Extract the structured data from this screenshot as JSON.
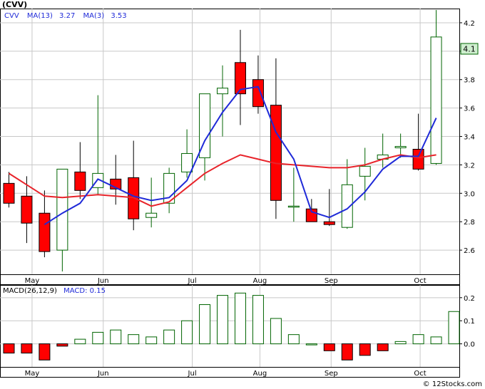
{
  "ticker": "(CVV)",
  "credit": "© 12Stocks.com",
  "price_badge": "4.1",
  "colors": {
    "up": "#006400",
    "down": "#ff0000",
    "ma13": "#e8232a",
    "ma3": "#1f2ad8",
    "grid": "#c8c8c8",
    "axis": "#000000",
    "label_blue": "#1f2ad8",
    "badge_bg": "#cfeecf"
  },
  "price_legend": {
    "series_name": "CVV",
    "ma13_label": "MA(13)",
    "ma13_value": "3.27",
    "ma3_label": "MA(3)",
    "ma3_value": "3.53"
  },
  "macd_legend": {
    "label": "MACD(26,12,9)",
    "value_label": "MACD: 0.15"
  },
  "chart_data": [
    {
      "type": "candlestick",
      "title": "(CVV)",
      "x_labels": [
        "May",
        "Jun",
        "Jul",
        "Aug",
        "Sep",
        "Oct"
      ],
      "x_label_weeks": [
        1.3,
        5.3,
        10.3,
        14.1,
        18.1,
        23.1
      ],
      "y_ticks": [
        "2.6",
        "2.8",
        "3.0",
        "3.2",
        "3.4",
        "3.6",
        "3.8",
        "4.0",
        "4.2"
      ],
      "y_tick_values": [
        2.6,
        2.8,
        3.0,
        3.2,
        3.4,
        3.6,
        3.8,
        4.0,
        4.2
      ],
      "ylim": [
        2.43,
        4.3
      ],
      "xlim": [
        -0.5,
        25.3
      ],
      "grid": true,
      "candles": [
        {
          "o": 3.07,
          "h": 3.15,
          "l": 2.9,
          "c": 2.93
        },
        {
          "o": 2.98,
          "h": 3.12,
          "l": 2.65,
          "c": 2.79
        },
        {
          "o": 2.86,
          "h": 3.02,
          "l": 2.55,
          "c": 2.59
        },
        {
          "o": 2.6,
          "h": 3.05,
          "l": 2.45,
          "c": 3.17
        },
        {
          "o": 3.15,
          "h": 3.36,
          "l": 2.96,
          "c": 3.02
        },
        {
          "o": 3.04,
          "h": 3.69,
          "l": 2.99,
          "c": 3.14
        },
        {
          "o": 3.1,
          "h": 3.27,
          "l": 2.92,
          "c": 3.03
        },
        {
          "o": 3.11,
          "h": 3.37,
          "l": 2.74,
          "c": 2.82
        },
        {
          "o": 2.83,
          "h": 3.11,
          "l": 2.76,
          "c": 2.86
        },
        {
          "o": 2.93,
          "h": 3.18,
          "l": 2.86,
          "c": 3.14
        },
        {
          "o": 3.15,
          "h": 3.45,
          "l": 3.11,
          "c": 3.28
        },
        {
          "o": 3.25,
          "h": 3.7,
          "l": 3.09,
          "c": 3.7
        },
        {
          "o": 3.7,
          "h": 3.9,
          "l": 3.4,
          "c": 3.74
        },
        {
          "o": 3.92,
          "h": 4.15,
          "l": 3.48,
          "c": 3.7
        },
        {
          "o": 3.8,
          "h": 3.97,
          "l": 3.56,
          "c": 3.61
        },
        {
          "o": 3.62,
          "h": 3.95,
          "l": 2.82,
          "c": 2.95
        },
        {
          "o": 2.91,
          "h": 3.18,
          "l": 2.8,
          "c": 2.91
        },
        {
          "o": 2.89,
          "h": 2.96,
          "l": 2.8,
          "c": 2.8
        },
        {
          "o": 2.8,
          "h": 3.03,
          "l": 2.77,
          "c": 2.78
        },
        {
          "o": 2.76,
          "h": 3.24,
          "l": 2.75,
          "c": 3.06
        },
        {
          "o": 3.12,
          "h": 3.32,
          "l": 2.95,
          "c": 3.19
        },
        {
          "o": 3.24,
          "h": 3.42,
          "l": 3.18,
          "c": 3.27
        },
        {
          "o": 3.32,
          "h": 3.42,
          "l": 3.25,
          "c": 3.33
        },
        {
          "o": 3.31,
          "h": 3.56,
          "l": 3.16,
          "c": 3.17
        },
        {
          "o": 3.21,
          "h": 4.29,
          "l": 3.2,
          "c": 4.1
        }
      ],
      "ma13": [
        3.14,
        3.06,
        2.98,
        2.97,
        2.98,
        2.99,
        2.98,
        2.97,
        2.91,
        2.94,
        3.04,
        3.14,
        3.21,
        3.27,
        3.24,
        3.21,
        3.2,
        3.19,
        3.18,
        3.18,
        3.2,
        3.24,
        3.27,
        3.25,
        3.27
      ],
      "ma3": [
        null,
        null,
        2.78,
        2.86,
        2.93,
        3.1,
        3.04,
        2.98,
        2.95,
        2.97,
        3.09,
        3.37,
        3.57,
        3.73,
        3.75,
        3.43,
        3.24,
        2.87,
        2.83,
        2.89,
        3.01,
        3.17,
        3.26,
        3.26,
        3.53
      ]
    },
    {
      "type": "bar",
      "title": "MACD(26,12,9)",
      "x_labels": [
        "May",
        "Jun",
        "Jul",
        "Aug",
        "Sep",
        "Oct"
      ],
      "y_ticks": [
        "0.0",
        "0.1",
        "0.2"
      ],
      "y_tick_values": [
        0.0,
        0.1,
        0.2
      ],
      "ylim": [
        -0.1,
        0.255
      ],
      "values": [
        -0.04,
        -0.04,
        -0.07,
        -0.01,
        0.02,
        0.05,
        0.06,
        0.04,
        0.03,
        0.06,
        0.1,
        0.17,
        0.21,
        0.22,
        0.21,
        0.11,
        0.04,
        0.0,
        -0.03,
        -0.07,
        -0.05,
        -0.03,
        0.01,
        0.04,
        0.03,
        0.14
      ]
    }
  ]
}
